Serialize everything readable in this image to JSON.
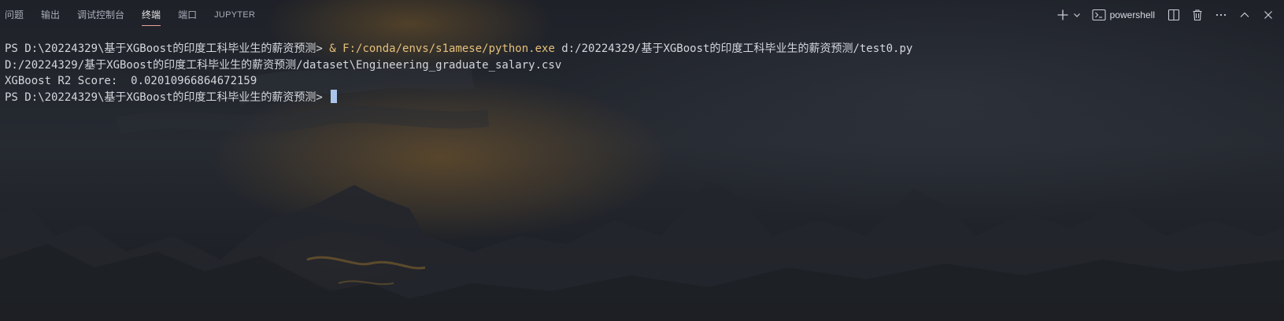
{
  "panel": {
    "tabs": [
      {
        "label": "问题"
      },
      {
        "label": "输出"
      },
      {
        "label": "调试控制台"
      },
      {
        "label": "终端",
        "active": true
      },
      {
        "label": "端口"
      },
      {
        "label": "JUPYTER"
      }
    ],
    "actions": {
      "shell_name": "powershell",
      "new_terminal_icon": "plus-icon",
      "dropdown_icon": "chevron-down-icon",
      "shell_icon": "terminal-icon",
      "split_icon": "split-editor-icon",
      "kill_icon": "trash-icon",
      "more_icon": "ellipsis-icon",
      "maximize_icon": "chevron-up-icon",
      "close_icon": "close-icon"
    }
  },
  "terminal": {
    "line1": {
      "prompt": "PS D:\\20224329\\基于XGBoost的印度工科毕业生的薪资预测> ",
      "ampersand": "& ",
      "exe": "F:/conda/envs/s1amese/python.exe",
      "script": " d:/20224329/基于XGBoost的印度工科毕业生的薪资预测/test0.py"
    },
    "line2": "D:/20224329/基于XGBoost的印度工科毕业生的薪资预测/dataset\\Engineering_graduate_salary.csv",
    "line3": "XGBoost R2 Score:  0.020109668646721​59",
    "line4": "PS D:\\20224329\\基于XGBoost的印度工科毕业生的薪资预测> "
  },
  "colors": {
    "accent_tab_underline": "#e8a0a0",
    "command_highlight": "#e5c07b",
    "cursor": "#a9c6ea"
  }
}
